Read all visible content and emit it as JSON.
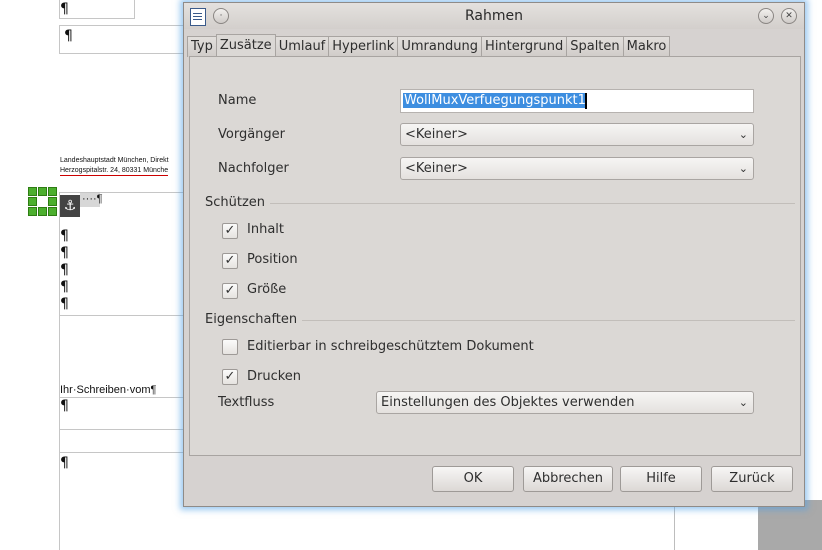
{
  "document": {
    "address_line1": "Landeshauptstadt München, Direkt",
    "address_line2": "Herzogspitalstr. 24, 80331 Münche",
    "pilcrow": "¶",
    "dots": "····¶",
    "ihr_schreiben": "Ihr·Schreiben·vom¶",
    "anchor_icon": "anchor-icon"
  },
  "dialog": {
    "title": "Rahmen",
    "icon": "document-icon",
    "buttons": {
      "shade": "chevron-down-icon",
      "close": "close-icon"
    },
    "tabs": [
      "Typ",
      "Zusätze",
      "Umlauf",
      "Hyperlink",
      "Umrandung",
      "Hintergrund",
      "Spalten",
      "Makro"
    ],
    "active_tab": "Zusätze",
    "fields": {
      "name_label": "Name",
      "name_value": "WollMuxVerfuegungspunkt1",
      "prev_label": "Vorgänger",
      "prev_value": "<Keiner>",
      "next_label": "Nachfolger",
      "next_value": "<Keiner>"
    },
    "protect": {
      "heading": "Schützen",
      "content_label": "Inhalt",
      "content_checked": true,
      "position_label": "Position",
      "position_checked": true,
      "size_label": "Größe",
      "size_checked": true
    },
    "properties": {
      "heading": "Eigenschaften",
      "editable_label": "Editierbar in schreibgeschütztem Dokument",
      "editable_checked": false,
      "print_label": "Drucken",
      "print_checked": true,
      "textflow_label": "Textfluss",
      "textflow_value": "Einstellungen des Objektes verwenden"
    },
    "footer": {
      "ok": "OK",
      "cancel": "Abbrechen",
      "help": "Hilfe",
      "back": "Zurück"
    }
  }
}
